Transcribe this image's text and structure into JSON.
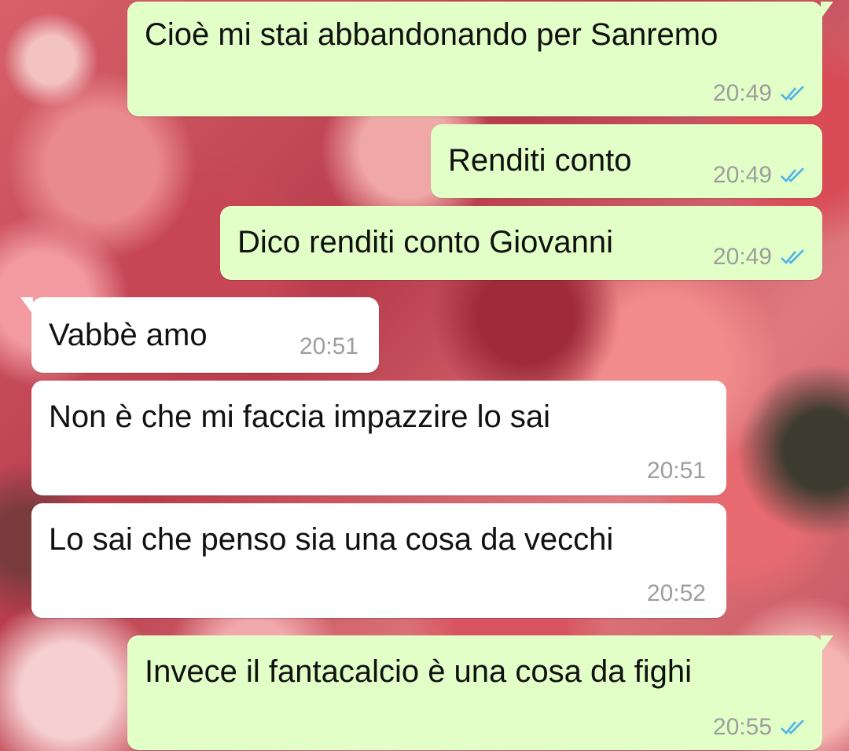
{
  "colors": {
    "outgoing_bubble": "#e1ffc7",
    "incoming_bubble": "#ffffff",
    "read_ticks": "#4fb3e8",
    "timestamp": "#9e9e9e"
  },
  "messages": [
    {
      "direction": "outgoing",
      "text": "Cioè mi stai abbandonando per Sanremo",
      "time": "20:49",
      "status_icon": "double-check-read-icon"
    },
    {
      "direction": "outgoing",
      "text": "Renditi conto",
      "time": "20:49",
      "status_icon": "double-check-read-icon"
    },
    {
      "direction": "outgoing",
      "text": "Dico renditi conto Giovanni",
      "time": "20:49",
      "status_icon": "double-check-read-icon"
    },
    {
      "direction": "incoming",
      "text": "Vabbè amo",
      "time": "20:51"
    },
    {
      "direction": "incoming",
      "text": "Non è che mi faccia impazzire lo sai",
      "time": "20:51"
    },
    {
      "direction": "incoming",
      "text": "Lo sai che penso sia una cosa da vecchi",
      "time": "20:52"
    },
    {
      "direction": "outgoing",
      "text": "Invece il fantacalcio è una cosa da fighi",
      "time": "20:55",
      "status_icon": "double-check-read-icon"
    }
  ]
}
